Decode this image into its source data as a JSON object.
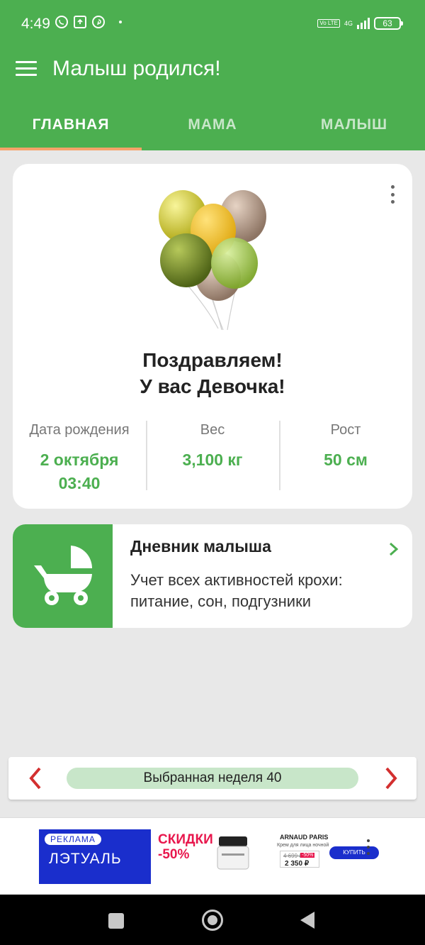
{
  "status_bar": {
    "time": "4:49",
    "volte": "Vo LTE",
    "network": "4G",
    "battery": "63",
    "icons": [
      "viber-icon",
      "upload-icon",
      "pinterest-icon"
    ]
  },
  "app_bar": {
    "title": "Малыш родился!"
  },
  "tabs": [
    {
      "label": "ГЛАВНАЯ",
      "active": true
    },
    {
      "label": "МАМА",
      "active": false
    },
    {
      "label": "МАЛЫШ",
      "active": false
    }
  ],
  "main_card": {
    "congrats_line1": "Поздравляем!",
    "congrats_line2": "У вас Девочка!",
    "stats": [
      {
        "label": "Дата рождения",
        "value_line1": "2 октября",
        "value_line2": "03:40"
      },
      {
        "label": "Вес",
        "value_line1": "3,100 кг",
        "value_line2": ""
      },
      {
        "label": "Рост",
        "value_line1": "50 см",
        "value_line2": ""
      }
    ]
  },
  "diary_card": {
    "title": "Дневник малыша",
    "description": "Учет всех активностей крохи: питание, сон, подгузники",
    "icon": "stroller-icon"
  },
  "week_selector": {
    "label": "Выбранная неделя 40"
  },
  "ad": {
    "tag": "РЕКЛАМА",
    "brand": "ЛЭТУАЛЬ",
    "sale_line1": "СКИДКИ",
    "sale_line2": "-50%",
    "product_brand": "ARNAUD PARIS",
    "product_desc": "Крем для лица ночной",
    "old_price": "4 699 ₽",
    "discount": "-50%",
    "new_price": "2 350 ₽",
    "buy_label": "КУПИТЬ"
  },
  "colors": {
    "primary": "#4caf50",
    "tab_indicator": "#f7a36a",
    "week_pill": "#c8e6c9",
    "arrow_red": "#d32f2f"
  }
}
